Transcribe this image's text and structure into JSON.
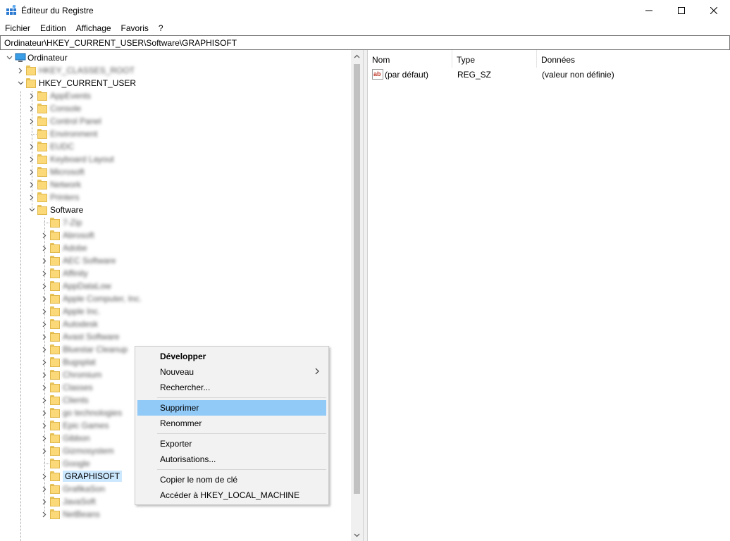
{
  "window": {
    "title": "Éditeur du Registre"
  },
  "menubar": [
    "Fichier",
    "Edition",
    "Affichage",
    "Favoris",
    "?"
  ],
  "address": "Ordinateur\\HKEY_CURRENT_USER\\Software\\GRAPHISOFT",
  "tree": {
    "root": "Ordinateur",
    "hkcr": "HKEY_CLASSES_ROOT",
    "hkcu": "HKEY_CURRENT_USER",
    "hkcu_children": [
      "AppEvents",
      "Console",
      "Control Panel",
      "Environment",
      "EUDC",
      "Keyboard Layout",
      "Microsoft",
      "Network",
      "Printers"
    ],
    "software": "Software",
    "software_children": [
      "7-Zip",
      "Abrosoft",
      "Adobe",
      "AEC Software",
      "Affinity",
      "AppDataLow",
      "Apple Computer, Inc.",
      "Apple Inc.",
      "Autodesk",
      "Avast Software",
      "Bluestar Cleanup",
      "Bugsplat",
      "Chromium",
      "Classes",
      "Clients",
      "go technologies",
      "Epic Games",
      "Gibbon",
      "Gizmosystem",
      "Google",
      "GRAPHISOFT",
      "GrafikaSon",
      "JavaSoft",
      "NetBeans"
    ],
    "selected": "GRAPHISOFT"
  },
  "values": {
    "columns": [
      "Nom",
      "Type",
      "Données"
    ],
    "rows": [
      {
        "name": "(par défaut)",
        "type": "REG_SZ",
        "data": "(valeur non définie)"
      }
    ]
  },
  "context_menu": {
    "items": [
      "Développer",
      "Nouveau",
      "Rechercher...",
      "Supprimer",
      "Renommer",
      "Exporter",
      "Autorisations...",
      "Copier le nom de clé",
      "Accéder à HKEY_LOCAL_MACHINE"
    ],
    "highlighted": "Supprimer"
  },
  "colors": {
    "highlight": "#91c9f7",
    "selection": "#cce8ff",
    "folder": "#fbd978"
  }
}
